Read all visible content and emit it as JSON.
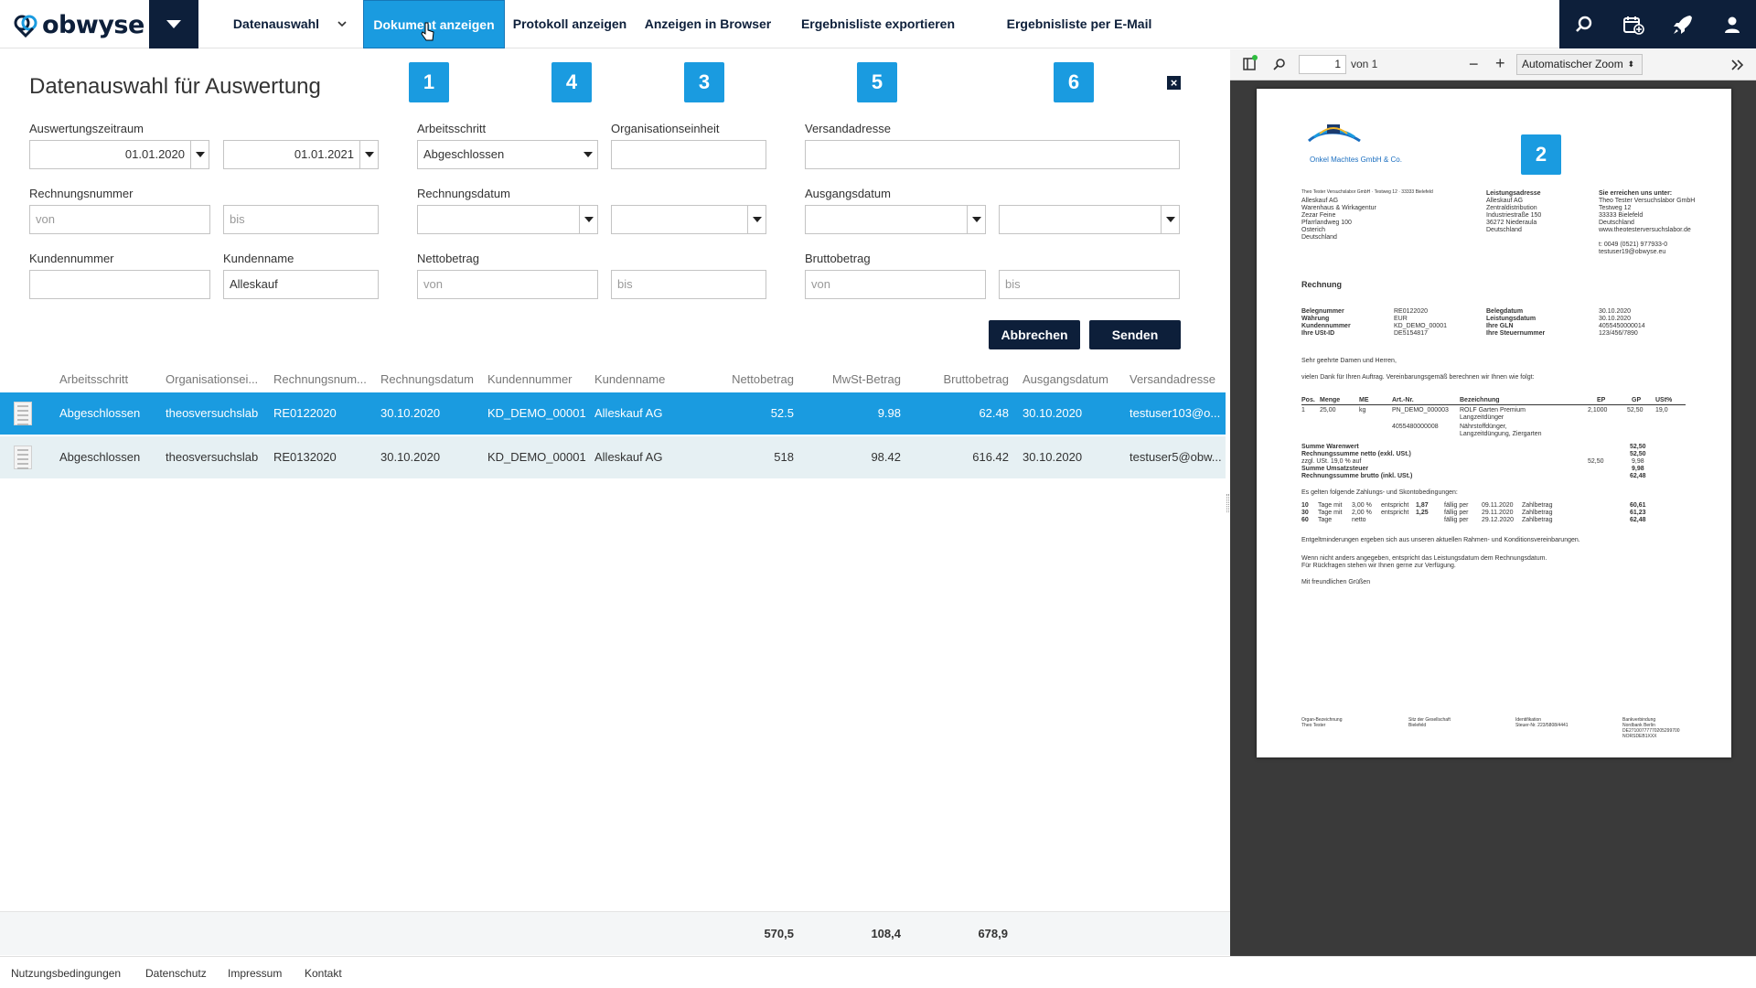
{
  "app": {
    "logo_text": "obwyse",
    "brand_color": "#0d1f3a",
    "accent_color": "#1a9be0"
  },
  "nav": {
    "items": [
      {
        "label": "Datenauswahl"
      },
      {
        "label": "Dokument anzeigen",
        "active": true
      },
      {
        "label": "Protokoll anzeigen"
      },
      {
        "label": "Anzeigen in Browser"
      },
      {
        "label": "Ergebnisliste exportieren (CSV)"
      },
      {
        "label": "Ergebnisliste per E-Mail (CSV)"
      }
    ],
    "tools": [
      "search-icon",
      "calendar-add-icon",
      "rocket-icon",
      "user-icon"
    ]
  },
  "page": {
    "title": "Datenauswahl für Auswertung"
  },
  "badges": [
    "1",
    "4",
    "3",
    "5",
    "6",
    "2"
  ],
  "form": {
    "auswertungszeitraum_label": "Auswertungszeitraum",
    "zeitraum_von": "01.01.2020",
    "zeitraum_bis": "01.01.2021",
    "arbeitsschritt_label": "Arbeitsschritt",
    "arbeitsschritt_value": "Abgeschlossen",
    "organisationseinheit_label": "Organisationseinheit",
    "versandadresse_label": "Versandadresse",
    "rechnungsnummer_label": "Rechnungsnummer",
    "von_placeholder": "von",
    "bis_placeholder": "bis",
    "rechnungsdatum_label": "Rechnungsdatum",
    "ausgangsdatum_label": "Ausgangsdatum",
    "kundennummer_label": "Kundennummer",
    "kundenname_label": "Kundenname",
    "kundenname_value": "Alleskauf",
    "nettobetrag_label": "Nettobetrag",
    "bruttobetrag_label": "Bruttobetrag",
    "cancel_label": "Abbrechen",
    "send_label": "Senden"
  },
  "table": {
    "headers": [
      "Arbeitsschritt",
      "Organisationsei...",
      "Rechnungsnum...",
      "Rechnungsdatum",
      "Kundennummer",
      "Kundenname",
      "Nettobetrag",
      "MwSt-Betrag",
      "Bruttobetrag",
      "Ausgangsdatum",
      "Versandadresse"
    ],
    "rows": [
      [
        "Abgeschlossen",
        "theosversuchslab",
        "RE0122020",
        "30.10.2020",
        "KD_DEMO_00001",
        "Alleskauf AG",
        "52.5",
        "9.98",
        "62.48",
        "30.10.2020",
        "testuser103@o..."
      ],
      [
        "Abgeschlossen",
        "theosversuchslab",
        "RE0132020",
        "30.10.2020",
        "KD_DEMO_00001",
        "Alleskauf AG",
        "518",
        "98.42",
        "616.42",
        "30.10.2020",
        "testuser5@obw..."
      ]
    ],
    "totals": {
      "netto": "570,5",
      "mwst": "108,4",
      "brutto": "678,9"
    }
  },
  "footer": {
    "links": [
      "Nutzungsbedingungen",
      "Datenschutz",
      "Impressum",
      "Kontakt"
    ]
  },
  "pdf": {
    "page_number": "1",
    "of_label": "von 1",
    "zoom_label": "Automatischer Zoom",
    "doc": {
      "company": "Onkel Machtes GmbH & Co.",
      "sender_line": "Theo Tester Versuchslabor GmbH · Testweg 12 · 33333 Bielefeld",
      "recipient": [
        "Alleskauf AG",
        "Warenhaus & Wirkagentur",
        "Zezar Feine",
        "Pfarrlandweg 100",
        "Osterich",
        "Deutschland"
      ],
      "delivery_heading": "Leistungsadresse",
      "delivery": [
        "Alleskauf AG",
        "Zentraldistribution",
        "Industriestraße 150",
        "36272 Niederaula",
        "Deutschland"
      ],
      "contact_heading": "Sie erreichen uns unter:",
      "contact": [
        "Theo Tester Versuchslabor GmbH",
        "Testweg 12",
        "33333 Bielefeld",
        "Deutschland",
        "www.theotesterversuchslabor.de",
        "",
        "t: 0049 (0521) 977933-0",
        "testuser19@obwyse.eu"
      ],
      "title": "Rechnung",
      "meta_left": [
        [
          "Belegnummer",
          "RE0122020"
        ],
        [
          "Währung",
          "EUR"
        ],
        [
          "Kundennummer",
          "KD_DEMO_00001"
        ],
        [
          "Ihre USt-ID",
          "DE5154817"
        ]
      ],
      "meta_right": [
        [
          "Belegdatum",
          "30.10.2020"
        ],
        [
          "Leistungsdatum",
          "30.10.2020"
        ],
        [
          "Ihre GLN",
          "4055450000014"
        ],
        [
          "Ihre Steuernummer",
          "123/456/7890"
        ]
      ],
      "salutation": "Sehr geehrte Damen und Herren,",
      "intro": "vielen Dank für Ihren Auftrag. Vereinbarungsgemäß berechnen wir Ihnen wie folgt:",
      "items_header": [
        "Pos.",
        "Menge",
        "ME",
        "Art.-Nr.",
        "Bezeichnung",
        "EP",
        "GP",
        "USt%"
      ],
      "item_row": [
        "1",
        "25,00",
        "kg",
        "PN_DEMO_000003",
        "ROLF Garten Premium",
        "2,1000",
        "52,50",
        "19,0"
      ],
      "item_sub1": "Langzeitdünger",
      "item_sub2": [
        "4055480000008",
        "Nährstoffdünger,",
        "Langzeitdüngung, Ziergarten"
      ],
      "sums": [
        [
          "Summe Warenwert",
          "52,50"
        ],
        [
          "Rechnungssumme netto (exkl. USt.)",
          "52,50"
        ],
        [
          "zzgl. USt. 19,0 % auf",
          "52,50",
          "9,98"
        ],
        [
          "Summe Umsatzsteuer",
          "9,98"
        ],
        [
          "Rechnungssumme brutto (inkl. USt.)",
          "62,48"
        ]
      ],
      "terms_intro": "Es gelten folgende Zahlungs- und Skontobedingungen:",
      "terms": [
        [
          "10",
          "Tage mit",
          "3,00 %",
          "entspricht",
          "1,87",
          "fällig per",
          "09.11.2020",
          "Zahlbetrag",
          "60,61"
        ],
        [
          "30",
          "Tage mit",
          "2,00 %",
          "entspricht",
          "1,25",
          "fällig per",
          "29.11.2020",
          "Zahlbetrag",
          "61,23"
        ],
        [
          "60",
          "Tage",
          "netto",
          "",
          "",
          "fällig per",
          "29.12.2020",
          "Zahlbetrag",
          "62,48"
        ]
      ],
      "note1": "Entgeltminderungen ergeben sich aus unseren aktuellen Rahmen- und Konditionsvereinbarungen.",
      "note2": "Wenn nicht anders angegeben, entspricht das Leistungsdatum dem Rechnungsdatum.",
      "note3": "Für Rückfragen stehen wir Ihnen gerne zur Verfügung.",
      "closing": "Mit freundlichen Grüßen",
      "footer_cols": [
        [
          "Organ-Bezeichnung",
          "Theo Tester"
        ],
        [
          "Sitz der Gesellschaft",
          "Bielefeld"
        ],
        [
          "Identifikation",
          "Steuer-Nr. 223/5808/4441"
        ],
        [
          "Bankverbindung",
          "Nordbank Berlin",
          "DE27100777770205299700",
          "NORSDEB1XXX"
        ]
      ]
    }
  }
}
